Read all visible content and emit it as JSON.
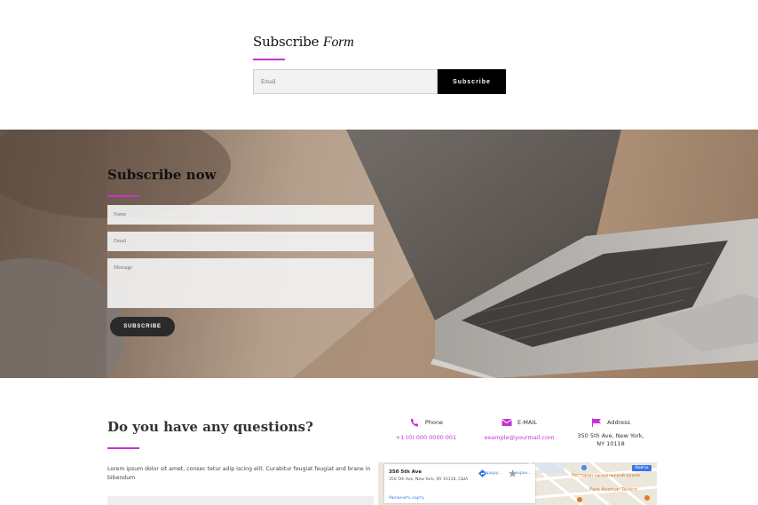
{
  "subscribe_form": {
    "title_bold": "Subscribe",
    "title_italic": "Form",
    "email_placeholder": "Email",
    "button_label": "Subscribe"
  },
  "hero": {
    "title": "Subscribe now",
    "name_placeholder": "Name",
    "email_placeholder": "Email",
    "message_placeholder": "Message",
    "button_label": "SUBSCRIBE"
  },
  "questions": {
    "title": "Do you have any questions?",
    "text": "Lorem ipsum dolor sit amet, consec tetur adip iscing elit. Curabitur feugiat feugiat and brane in bibendum"
  },
  "contact": [
    {
      "label": "Phone",
      "value": "+1 (0) 000 0000 001",
      "icon": "phone-icon"
    },
    {
      "label": "E-MAIL",
      "value": "example@yourmail.com",
      "icon": "mail-icon"
    },
    {
      "label": "Address",
      "value": "350 5th Ave, New York, NY 10118",
      "icon": "flag-icon"
    }
  ],
  "map": {
    "place_name": "350 5th Ave",
    "place_address": "350 5th Ave, New York, NY 10118, США",
    "enlarge_link": "Увеличить карту",
    "route_label": "Маршру...",
    "save_label": "Сохран...",
    "signin_label": "Войти",
    "poi_restaurant": "Ресторан сычуаньской кухни",
    "poi_tavern": "Park Avenue Tavern"
  },
  "colors": {
    "accent": "#c533d3",
    "button_dark": "#000000"
  }
}
